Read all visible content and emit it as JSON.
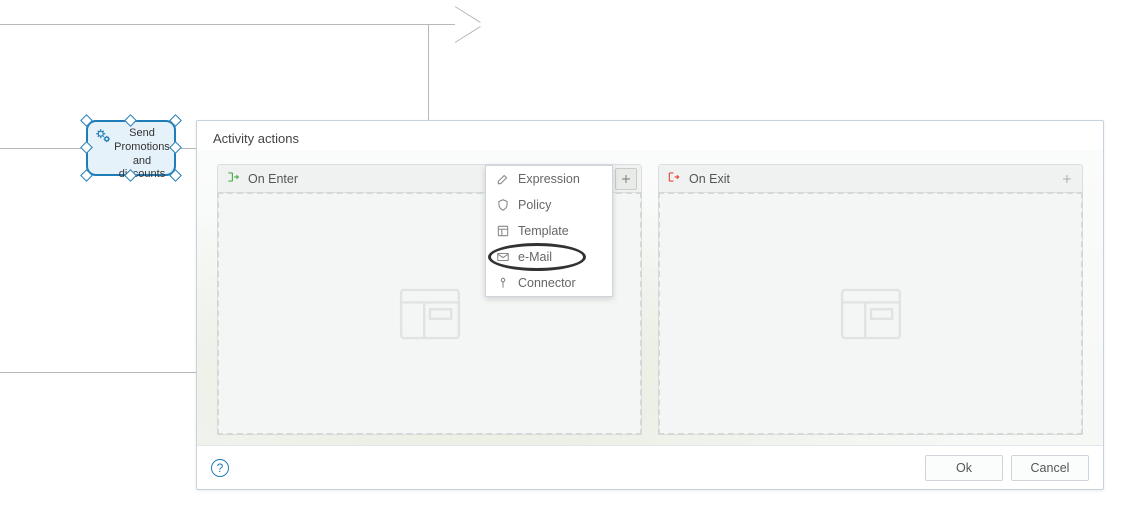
{
  "activity_node": {
    "label": "Send Promotions and discounts"
  },
  "dialog": {
    "title": "Activity actions",
    "on_enter": {
      "label": "On Enter"
    },
    "on_exit": {
      "label": "On Exit"
    },
    "dropdown": {
      "items": [
        {
          "label": "Expression",
          "icon": "edit"
        },
        {
          "label": "Policy",
          "icon": "shield"
        },
        {
          "label": "Template",
          "icon": "template"
        },
        {
          "label": "e-Mail",
          "icon": "mail"
        },
        {
          "label": "Connector",
          "icon": "connector"
        }
      ]
    },
    "buttons": {
      "ok": "Ok",
      "cancel": "Cancel"
    }
  }
}
